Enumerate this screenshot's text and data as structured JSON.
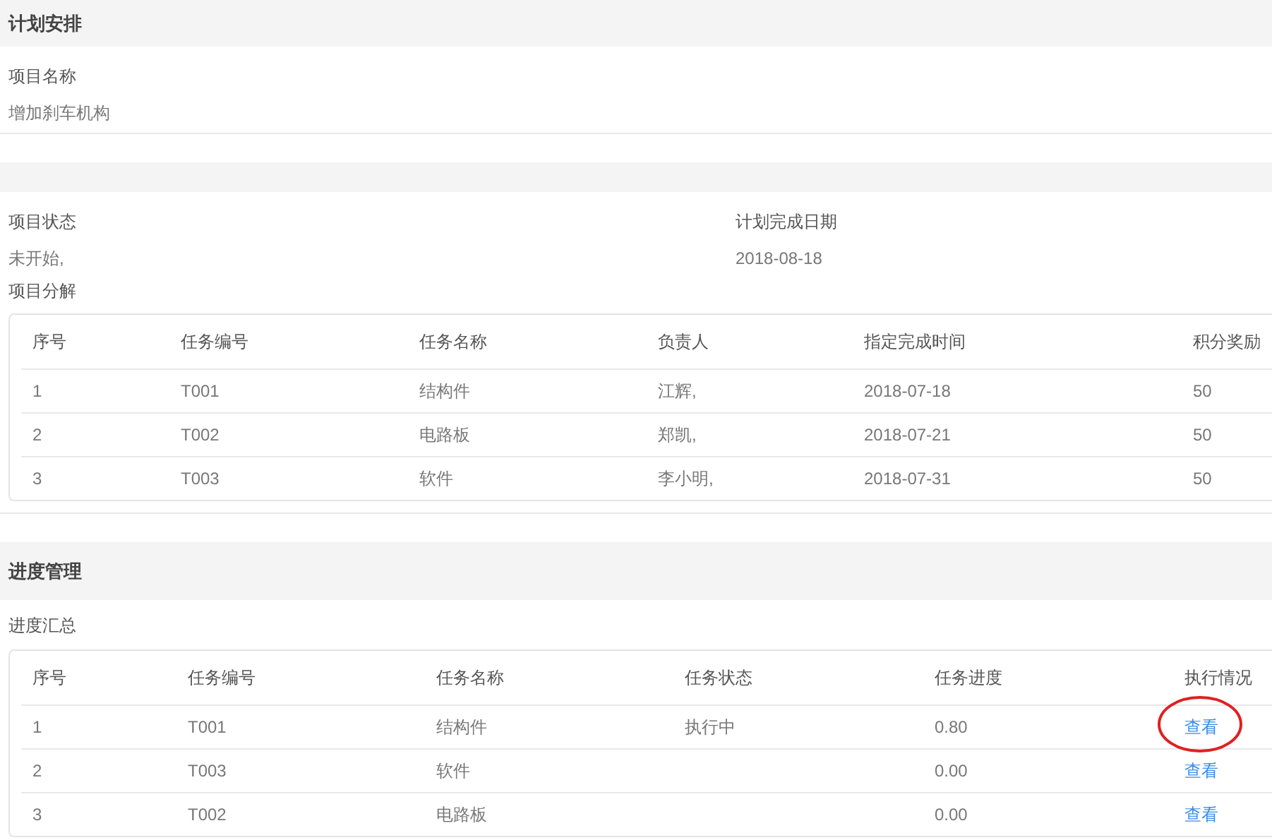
{
  "plan_section": {
    "title": "计划安排"
  },
  "project_name": {
    "label": "项目名称",
    "value": "增加刹车机构"
  },
  "project_status": {
    "label": "项目状态",
    "value": "未开始,"
  },
  "planned_date": {
    "label": "计划完成日期",
    "value": "2018-08-18"
  },
  "breakdown": {
    "title": "项目分解",
    "columns": [
      "序号",
      "任务编号",
      "任务名称",
      "负责人",
      "指定完成时间",
      "积分奖励"
    ],
    "rows": [
      [
        "1",
        "T001",
        "结构件",
        "江辉,",
        "2018-07-18",
        "50"
      ],
      [
        "2",
        "T002",
        "电路板",
        "郑凯,",
        "2018-07-21",
        "50"
      ],
      [
        "3",
        "T003",
        "软件",
        "李小明,",
        "2018-07-31",
        "50"
      ]
    ]
  },
  "progress_section": {
    "title": "进度管理"
  },
  "summary": {
    "title": "进度汇总",
    "columns": [
      "序号",
      "任务编号",
      "任务名称",
      "任务状态",
      "任务进度",
      "执行情况"
    ],
    "rows": [
      {
        "cells": [
          "1",
          "T001",
          "结构件",
          "执行中",
          "0.80"
        ],
        "action": "查看",
        "circled": true
      },
      {
        "cells": [
          "2",
          "T003",
          "软件",
          "",
          "0.00"
        ],
        "action": "查看",
        "circled": false
      },
      {
        "cells": [
          "3",
          "T002",
          "电路板",
          "",
          "0.00"
        ],
        "action": "查看",
        "circled": false
      }
    ]
  }
}
